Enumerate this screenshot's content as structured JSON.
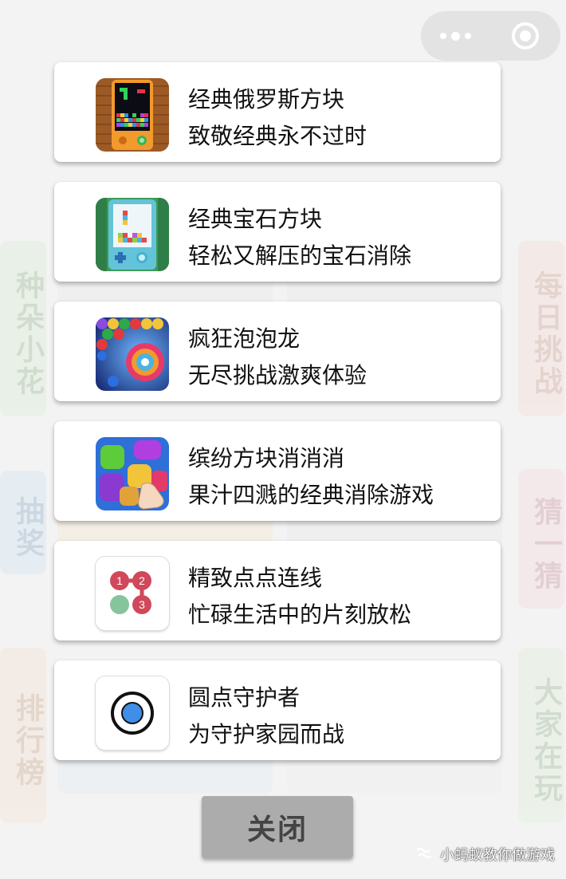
{
  "capsule": {
    "more_icon": "more-dots-icon",
    "close_icon": "capsule-target-icon"
  },
  "games": [
    {
      "title": "经典俄罗斯方块",
      "desc": "致敬经典永不过时",
      "icon": "tetris-icon"
    },
    {
      "title": "经典宝石方块",
      "desc": "轻松又解压的宝石消除",
      "icon": "gem-block-icon"
    },
    {
      "title": "疯狂泡泡龙",
      "desc": "无尽挑战激爽体验",
      "icon": "bubble-shooter-icon"
    },
    {
      "title": "缤纷方块消消消",
      "desc": "果汁四溅的经典消除游戏",
      "icon": "candy-match-icon"
    },
    {
      "title": "精致点点连线",
      "desc": "忙碌生活中的片刻放松",
      "icon": "dot-connect-icon"
    },
    {
      "title": "圆点守护者",
      "desc": "为守护家园而战",
      "icon": "dot-guardian-icon"
    }
  ],
  "dot_connect_numbers": [
    "1",
    "2",
    "3"
  ],
  "close_button": {
    "label": "关闭"
  },
  "watermark": {
    "text": "小蚂蚁教你做游戏"
  },
  "background_labels": {
    "left_top": "种朵小花",
    "left_mid": "抽奖",
    "left_bottom": "排行榜",
    "right_top": "每日挑战",
    "right_mid": "猜一猜",
    "right_bottom": "大家在玩"
  },
  "colors": {
    "card_bg": "#ffffff",
    "close_bg": "#acacac",
    "close_text": "#444444",
    "dot_red": "#d0485a",
    "dot_green": "#86c49c",
    "guardian_blue": "#3f8ee8"
  }
}
